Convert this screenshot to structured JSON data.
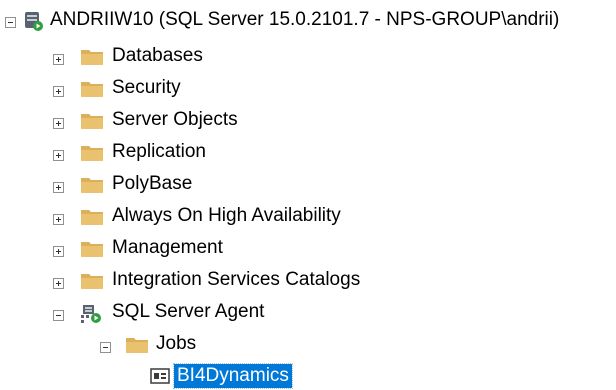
{
  "tree": {
    "server": {
      "label": "ANDRIIW10 (SQL Server 15.0.2101.7 - NPS-GROUP\\andrii)",
      "icon": "server-icon",
      "expanded": true
    },
    "folders": [
      {
        "label": "Databases",
        "expanded": false
      },
      {
        "label": "Security",
        "expanded": false
      },
      {
        "label": "Server Objects",
        "expanded": false
      },
      {
        "label": "Replication",
        "expanded": false
      },
      {
        "label": "PolyBase",
        "expanded": false
      },
      {
        "label": "Always On High Availability",
        "expanded": false
      },
      {
        "label": "Management",
        "expanded": false
      },
      {
        "label": "Integration Services Catalogs",
        "expanded": false
      }
    ],
    "agent": {
      "label": "SQL Server Agent",
      "icon": "sql-agent-icon",
      "expanded": true
    },
    "jobs": {
      "label": "Jobs",
      "expanded": true
    },
    "job": {
      "label": "BI4Dynamics",
      "icon": "job-icon",
      "selected": true
    }
  },
  "colors": {
    "folder": "#dcb05b",
    "selection": "#0078d7",
    "expander_border": "#919191",
    "agent_green": "#2e9e3f"
  }
}
